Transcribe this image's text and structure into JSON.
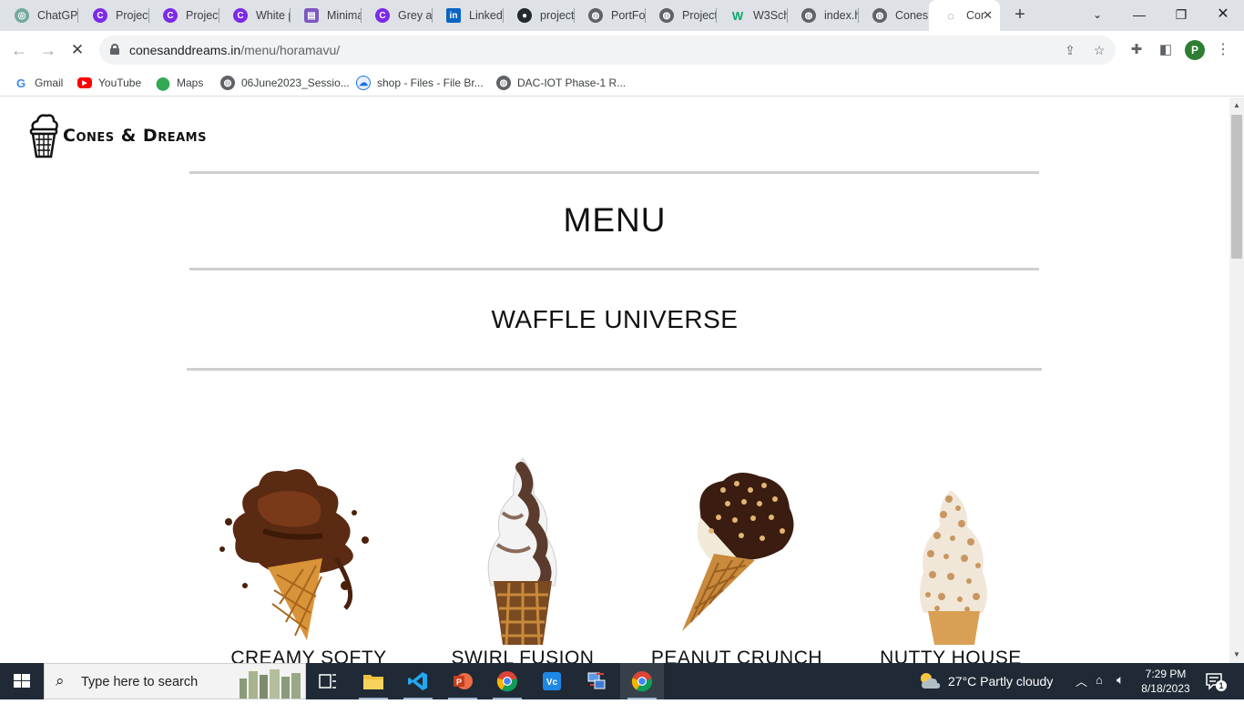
{
  "browser": {
    "tabs": [
      {
        "label": "ChatGPT",
        "icon": "openai-icon",
        "color": "#74aa9c"
      },
      {
        "label": "Project",
        "icon": "canva-icon",
        "color": "#7d2ae8"
      },
      {
        "label": "Project",
        "icon": "canva-icon",
        "color": "#7d2ae8"
      },
      {
        "label": "White p",
        "icon": "canva-icon",
        "color": "#7d2ae8"
      },
      {
        "label": "Minima",
        "icon": "printer-icon",
        "color": "#7e57c2"
      },
      {
        "label": "Grey ar",
        "icon": "canva-icon",
        "color": "#7d2ae8"
      },
      {
        "label": "LinkedI",
        "icon": "linkedin-icon",
        "color": "#0a66c2"
      },
      {
        "label": "project",
        "icon": "github-icon",
        "color": "#24292f"
      },
      {
        "label": "PortFol",
        "icon": "globe-icon",
        "color": "#5f6368"
      },
      {
        "label": "Project",
        "icon": "globe-icon",
        "color": "#5f6368"
      },
      {
        "label": "W3Sch",
        "icon": "w3schools-icon",
        "color": "#04aa6d"
      },
      {
        "label": "index.h",
        "icon": "globe-icon",
        "color": "#5f6368"
      },
      {
        "label": "Cones",
        "icon": "globe-icon",
        "color": "#5f6368"
      },
      {
        "label": "Cor",
        "icon": "loading-icon",
        "color": "#5f6368"
      }
    ],
    "url_host": "conesanddreams.in",
    "url_path": "/menu/horamavu/",
    "profile_initial": "P",
    "bookmarks": [
      {
        "label": "Gmail",
        "icon": "google-icon",
        "color": "#4285f4"
      },
      {
        "label": "YouTube",
        "icon": "youtube-icon",
        "color": "#ff0000"
      },
      {
        "label": "Maps",
        "icon": "maps-pin-icon",
        "color": "#34a853"
      },
      {
        "label": "06June2023_Sessio...",
        "icon": "globe-icon",
        "color": "#5f6368"
      },
      {
        "label": "shop - Files - File Br...",
        "icon": "file-browser-icon",
        "color": "#1a73e8"
      },
      {
        "label": "DAC-IOT Phase-1 R...",
        "icon": "globe-icon",
        "color": "#5f6368"
      }
    ]
  },
  "site": {
    "brand": "Cones & Dreams",
    "menu_title": "MENU",
    "section_title": "WAFFLE UNIVERSE",
    "products": [
      {
        "name": "CREAMY SOFTY",
        "image": "chocolate-softy-cone"
      },
      {
        "name": "SWIRL FUSION",
        "image": "swirl-cone"
      },
      {
        "name": "PEANUT CRUNCH",
        "image": "peanut-cone"
      },
      {
        "name": "NUTTY HOUSE",
        "image": "nutty-cone"
      }
    ]
  },
  "taskbar": {
    "search_placeholder": "Type here to search",
    "weather": "27°C  Partly cloudy",
    "time": "7:29 PM",
    "date": "8/18/2023",
    "notification_count": "1"
  }
}
